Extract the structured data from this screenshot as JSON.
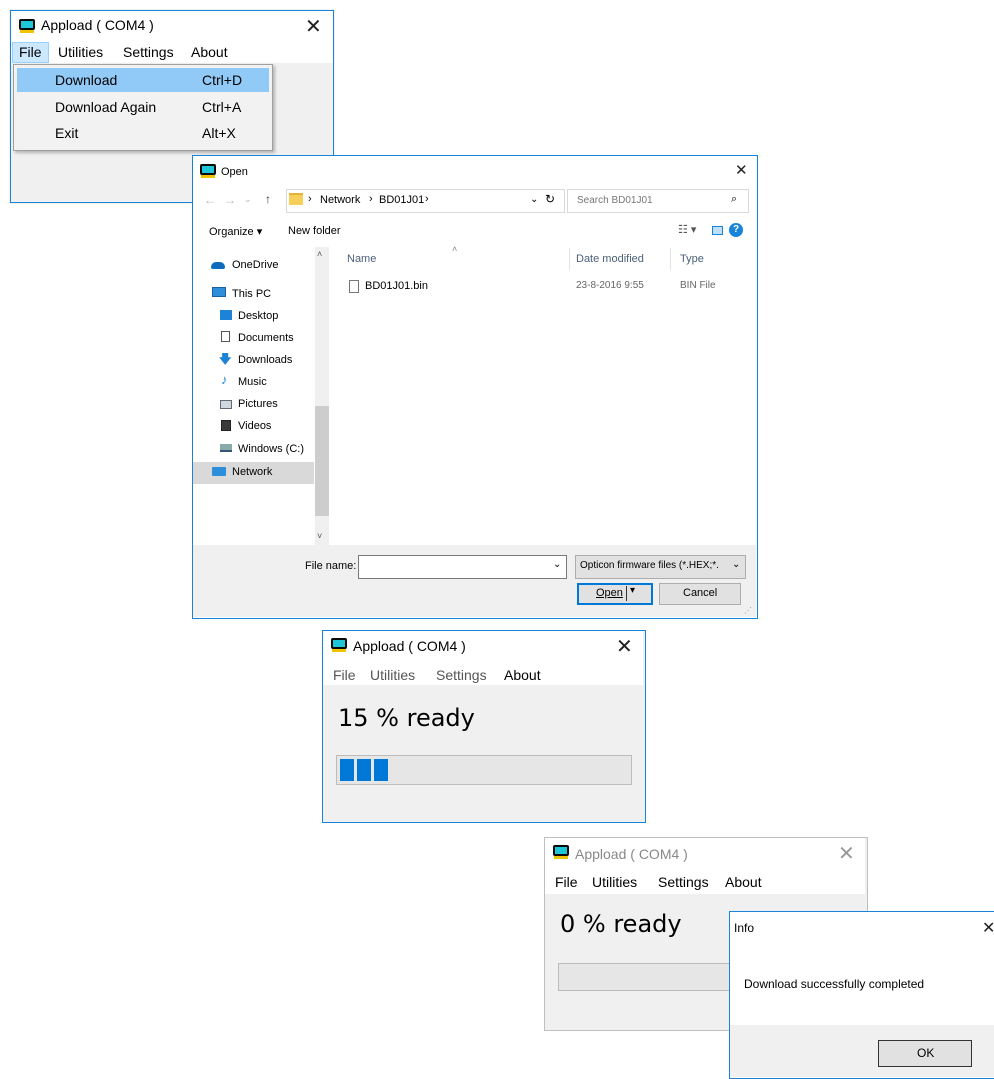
{
  "app1": {
    "title": "Appload ( COM4 )",
    "menus": [
      "File",
      "Utilities",
      "Settings",
      "About"
    ],
    "file_menu": [
      {
        "label": "Download",
        "shortcut": "Ctrl+D"
      },
      {
        "label": "Download Again",
        "shortcut": "Ctrl+A"
      },
      {
        "label": "Exit",
        "shortcut": "Alt+X"
      }
    ]
  },
  "open_dialog": {
    "title": "Open",
    "breadcrumb": [
      "Network",
      "BD01J01"
    ],
    "search_placeholder": "Search BD01J01",
    "toolbar": {
      "organize": "Organize ▾",
      "new_folder": "New folder"
    },
    "nav_items": [
      {
        "label": "OneDrive",
        "icon": "onedrive-icon"
      },
      {
        "label": "This PC",
        "icon": "computer-icon"
      },
      {
        "label": "Desktop",
        "icon": "desktop-icon"
      },
      {
        "label": "Documents",
        "icon": "documents-icon"
      },
      {
        "label": "Downloads",
        "icon": "downloads-icon"
      },
      {
        "label": "Music",
        "icon": "music-icon"
      },
      {
        "label": "Pictures",
        "icon": "pictures-icon"
      },
      {
        "label": "Videos",
        "icon": "videos-icon"
      },
      {
        "label": "Windows (C:)",
        "icon": "drive-icon"
      },
      {
        "label": "Network",
        "icon": "network-icon"
      }
    ],
    "columns": [
      "Name",
      "Date modified",
      "Type"
    ],
    "files": [
      {
        "name": "BD01J01.bin",
        "date": "23-8-2016 9:55",
        "type": "BIN File"
      }
    ],
    "file_name_label": "File name:",
    "file_name_value": "",
    "file_type": "Opticon firmware files (*.HEX;*.",
    "open_button": "Open",
    "cancel_button": "Cancel"
  },
  "app2": {
    "title": "Appload ( COM4 )",
    "menus": [
      "File",
      "Utilities",
      "Settings",
      "About"
    ],
    "status": "15 % ready",
    "progress": 0.15
  },
  "app3": {
    "title": "Appload ( COM4 )",
    "menus": [
      "File",
      "Utilities",
      "Settings",
      "About"
    ],
    "status": "0 % ready",
    "progress": 0
  },
  "info_dialog": {
    "title": "Info",
    "message": "Download successfully completed",
    "ok_button": "OK"
  },
  "colors": {
    "accent": "#0078d7",
    "highlight": "#91c9f7"
  }
}
